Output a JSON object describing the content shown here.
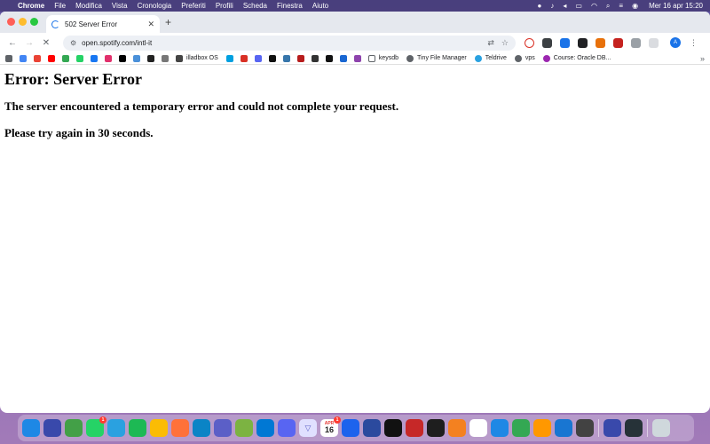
{
  "menubar": {
    "apple_icon": "apple-icon",
    "items": [
      "Chrome",
      "File",
      "Modifica",
      "Vista",
      "Cronologia",
      "Preferiti",
      "Profili",
      "Scheda",
      "Finestra",
      "Aiuto"
    ],
    "clock": "Mer 16 apr  15:20"
  },
  "tab": {
    "title": "502 Server Error",
    "close_glyph": "✕",
    "new_tab_glyph": "+"
  },
  "toolbar": {
    "back_glyph": "←",
    "forward_glyph": "→",
    "stop_glyph": "✕",
    "url": "open.spotify.com/intl-it",
    "avatar_letter": "A"
  },
  "bookmarks": {
    "items": [
      {
        "label": "illadbox OS"
      },
      {
        "label": "keysdb"
      },
      {
        "label": "Tiny File Manager"
      },
      {
        "label": "Teldrive"
      },
      {
        "label": "vps"
      },
      {
        "label": "Course: Oracle DB..."
      }
    ],
    "more_glyph": "»"
  },
  "page": {
    "heading": "Error: Server Error",
    "message": "The server encountered a temporary error and could not complete your request.",
    "retry": "Please try again in 30 seconds."
  },
  "dock": {
    "calendar_month": "APR",
    "calendar_day": "16",
    "badge_whatsapp": "1",
    "badge_calendar": "1"
  },
  "colors": {
    "accent": "#1a73e8",
    "tab_strip": "#e5e8ee",
    "omnibox": "#edf0f5"
  }
}
